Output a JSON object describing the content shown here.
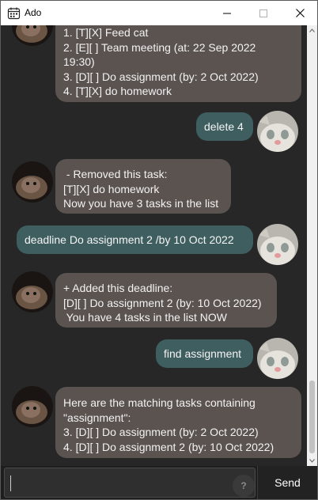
{
  "window": {
    "title": "Ado"
  },
  "messages": [
    {
      "from": "bot",
      "lines": [
        "1. [T][X] Feed cat",
        "2. [E][ ] Team meeting (at: 22 Sep 2022",
        "19:30)",
        "3. [D][ ] Do assignment (by: 2 Oct 2022)",
        "4. [T][X] do homework"
      ]
    },
    {
      "from": "user",
      "lines": [
        "delete 4"
      ]
    },
    {
      "from": "bot",
      "lines": [
        " - Removed this task:",
        "[T][X] do homework",
        "Now you have 3 tasks in the list"
      ]
    },
    {
      "from": "user",
      "lines": [
        "deadline Do assignment 2 /by 10 Oct 2022"
      ]
    },
    {
      "from": "bot",
      "lines": [
        "+ Added this deadline:",
        "[D][ ] Do assignment 2 (by: 10 Oct 2022)",
        " You have 4 tasks in the list NOW"
      ]
    },
    {
      "from": "user",
      "lines": [
        "find assignment"
      ]
    },
    {
      "from": "bot",
      "lines": [
        "Here are the matching tasks containing",
        "\"assignment\":",
        "3. [D][ ] Do assignment (by: 2 Oct 2022)",
        "4. [D][ ] Do assignment 2 (by: 10 Oct 2022)"
      ]
    }
  ],
  "input": {
    "value": "",
    "help_label": "?",
    "send_label": "Send"
  },
  "icons": {
    "calendar": "calendar-icon",
    "minimize": "minimize-icon",
    "maximize": "maximize-icon",
    "close": "close-icon"
  },
  "colors": {
    "bot_bubble": "#5b5350",
    "user_bubble": "#3f5e60",
    "background": "#272727"
  }
}
